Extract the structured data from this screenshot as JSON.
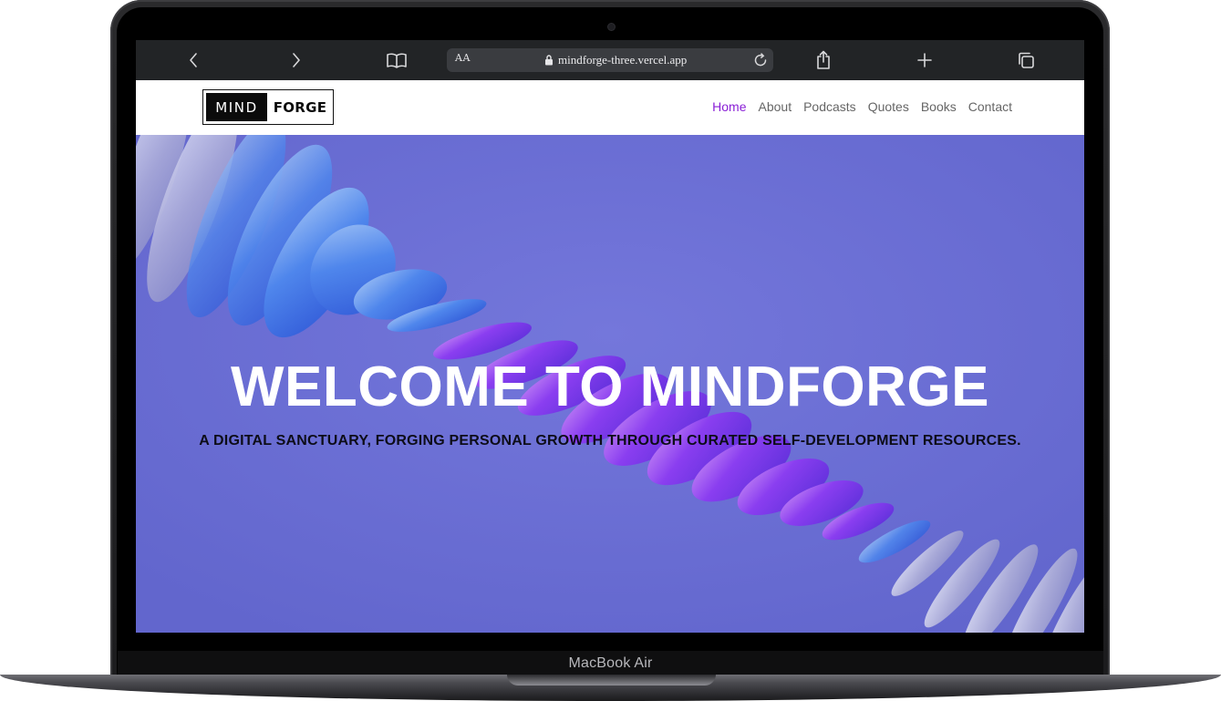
{
  "device": {
    "chin_label": "MacBook Air"
  },
  "browser": {
    "back_icon": "chevron-left-icon",
    "forward_icon": "chevron-right-icon",
    "bookmarks_icon": "book-icon",
    "reader_label": "AA",
    "url": "mindforge-three.vercel.app",
    "lock_icon": "lock-icon",
    "reload_icon": "reload-icon",
    "share_icon": "share-icon",
    "new_tab_icon": "plus-icon",
    "tabs_icon": "tabs-icon"
  },
  "site": {
    "logo": {
      "left": "MIND",
      "right": "FORGE"
    },
    "nav": [
      {
        "label": "Home",
        "active": true
      },
      {
        "label": "About",
        "active": false
      },
      {
        "label": "Podcasts",
        "active": false
      },
      {
        "label": "Quotes",
        "active": false
      },
      {
        "label": "Books",
        "active": false
      },
      {
        "label": "Contact",
        "active": false
      }
    ],
    "hero": {
      "title": "WELCOME TO MINDFORGE",
      "subtitle": "A DIGITAL SANCTUARY, FORGING PERSONAL GROWTH THROUGH CURATED SELF-DEVELOPMENT RESOURCES."
    }
  },
  "colors": {
    "hero_background": "#6b6ed4",
    "nav_active": "#8a1fd6",
    "nav_default": "#666666",
    "browser_bar": "#222426"
  }
}
